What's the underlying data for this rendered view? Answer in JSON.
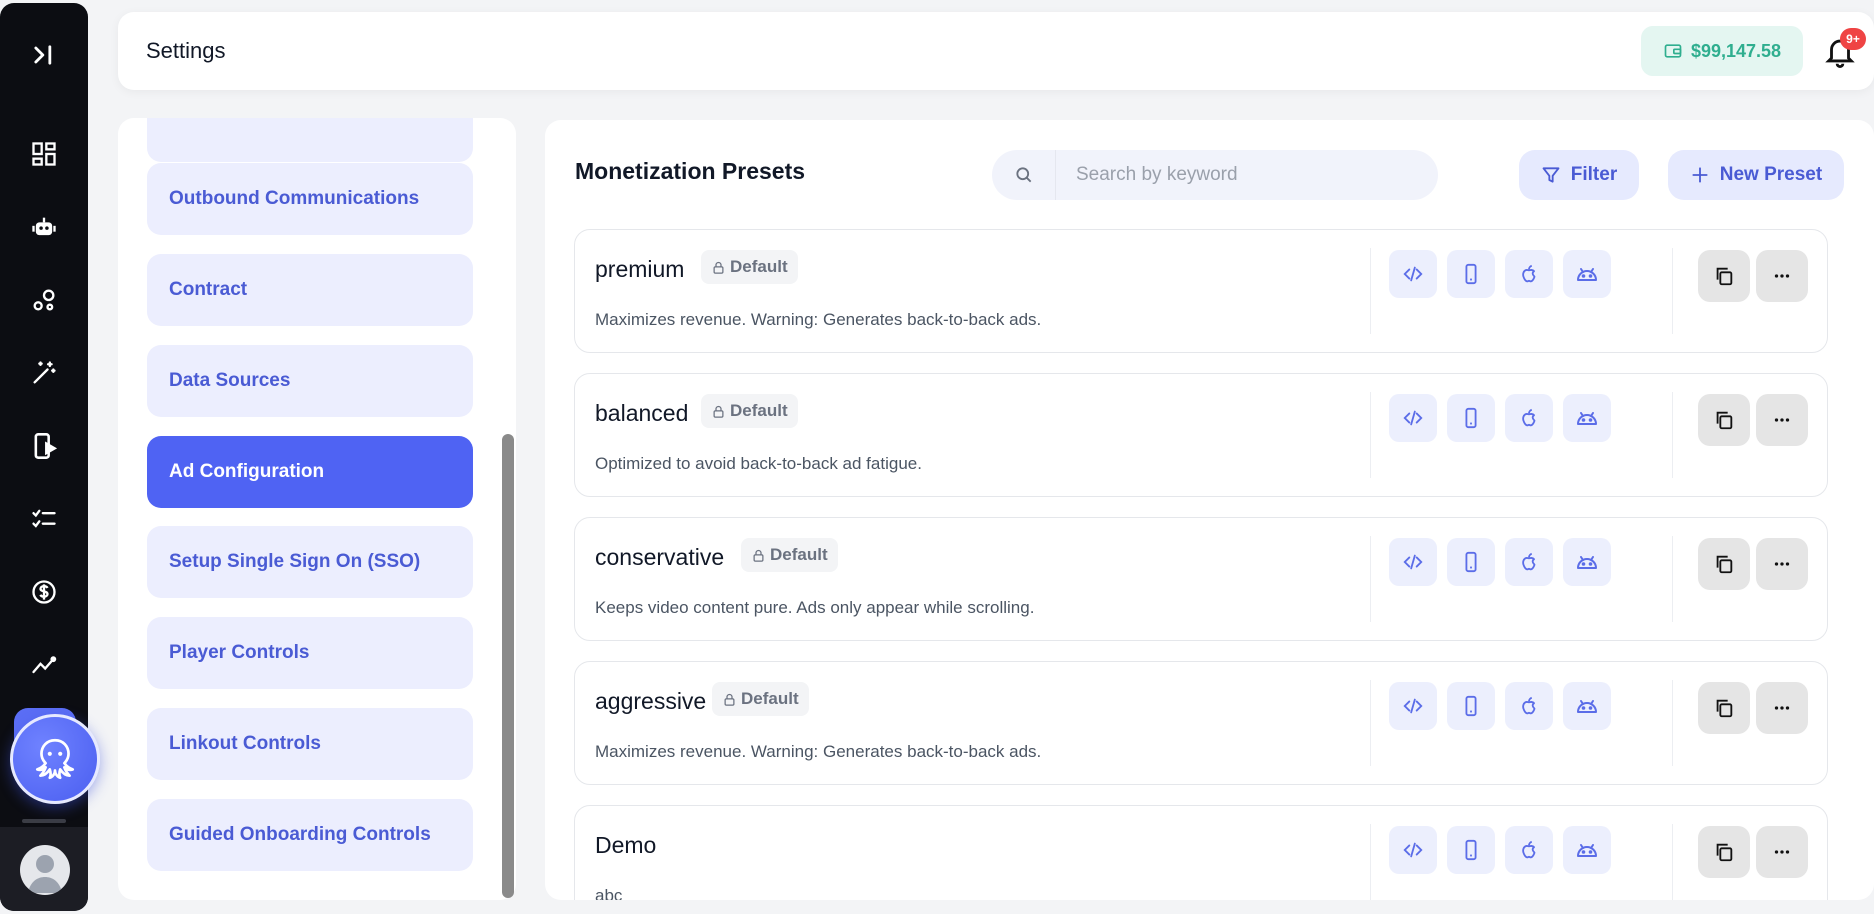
{
  "header": {
    "title": "Settings",
    "balance": "$99,147.58",
    "notification_badge": "9+"
  },
  "rail": {
    "icons": [
      "collapse-sidebar-icon",
      "dashboard-icon",
      "robot-icon",
      "nodes-icon",
      "magic-wand-icon",
      "mobile-play-icon",
      "checklist-icon",
      "dollar-icon",
      "trend-icon"
    ]
  },
  "settings_nav": {
    "items": [
      {
        "label": ""
      },
      {
        "label": "Outbound Communications"
      },
      {
        "label": "Contract"
      },
      {
        "label": "Data Sources"
      },
      {
        "label": "Ad Configuration",
        "active": true
      },
      {
        "label": "Setup Single Sign On (SSO)"
      },
      {
        "label": "Player Controls"
      },
      {
        "label": "Linkout Controls"
      },
      {
        "label": "Guided Onboarding Controls"
      }
    ]
  },
  "main": {
    "title": "Monetization Presets",
    "search": {
      "placeholder": "Search by keyword",
      "value": ""
    },
    "filter_label": "Filter",
    "new_preset_label": "New Preset",
    "presets": [
      {
        "name": "premium",
        "tag": "Default",
        "description": "Maximizes revenue. Warning: Generates back-to-back ads."
      },
      {
        "name": "balanced",
        "tag": "Default",
        "description": "Optimized to avoid back-to-back ad fatigue."
      },
      {
        "name": "conservative",
        "tag": "Default",
        "description": "Keeps video content pure. Ads only appear while scrolling."
      },
      {
        "name": "aggressive",
        "tag": "Default",
        "description": "Maximizes revenue. Warning: Generates back-to-back ads."
      },
      {
        "name": "Demo",
        "tag": "",
        "description": "abc"
      }
    ]
  },
  "colors": {
    "accent": "#4f63f3",
    "balance_green": "#2fae8f",
    "badge_red": "#ef4444",
    "rail_bg": "#0c0d12"
  }
}
